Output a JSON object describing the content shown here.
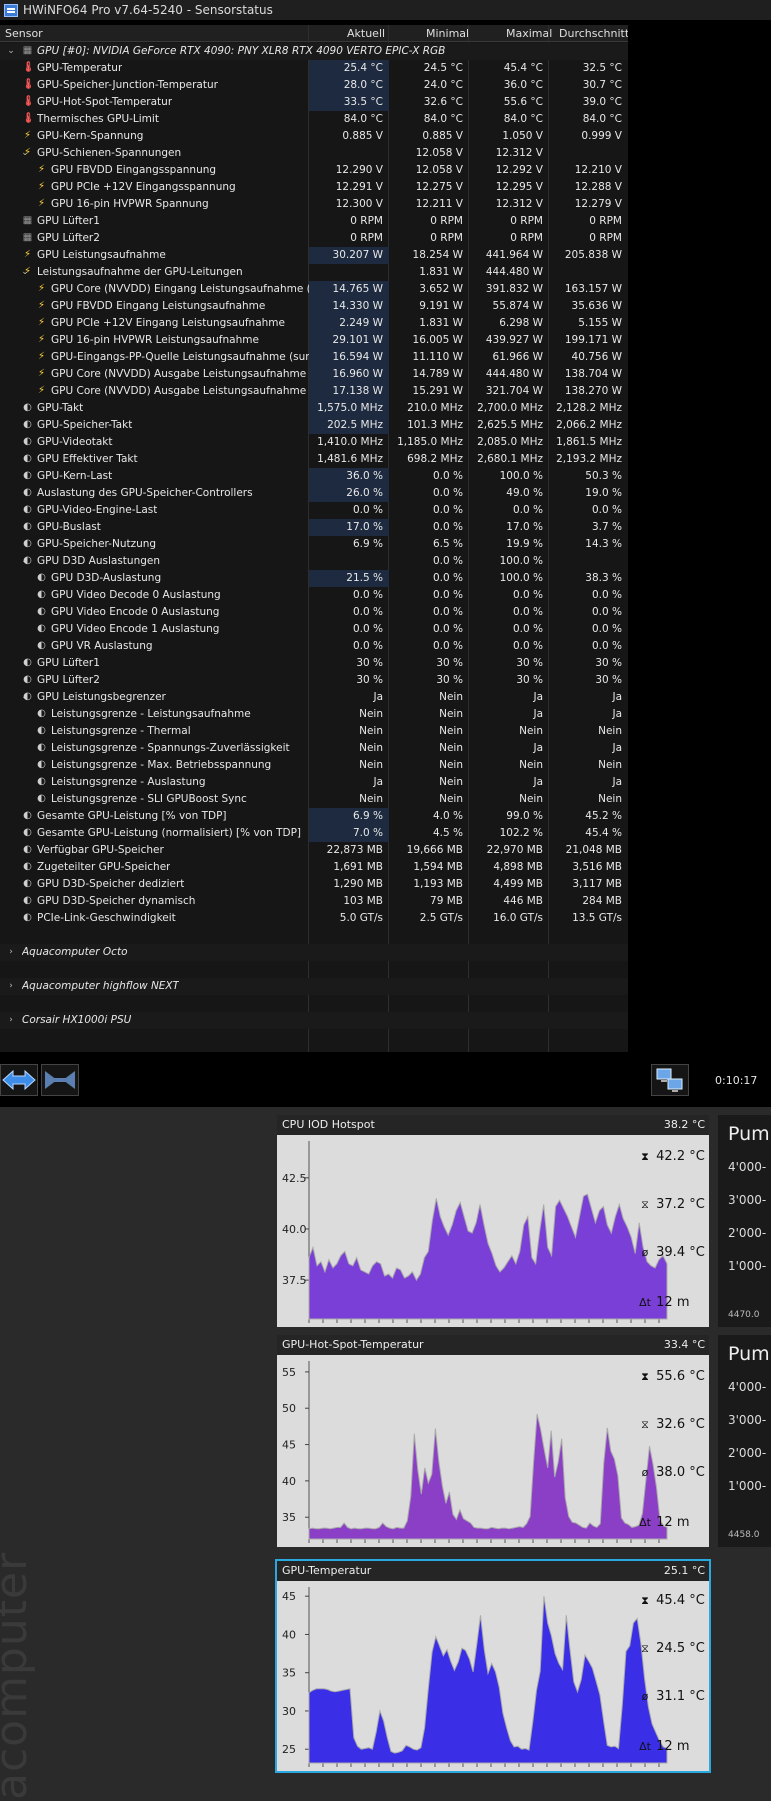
{
  "window": {
    "title": "HWiNFO64 Pro v7.64-5240 - Sensorstatus"
  },
  "columns": [
    "Sensor",
    "Aktuell",
    "Minimal",
    "Maximal",
    "Durchschnitt"
  ],
  "rows": [
    {
      "indent": 0,
      "exp": "down",
      "icon": "chip",
      "label": "GPU [#0]: NVIDIA GeForce RTX 4090: PNY XLR8 RTX 4090 VERTO EPIC-X RGB",
      "italic": true,
      "group": true,
      "v": [
        "",
        "",
        "",
        ""
      ]
    },
    {
      "indent": 1,
      "icon": "therm",
      "label": "GPU-Temperatur",
      "hl": true,
      "v": [
        "25.4 °C",
        "24.5 °C",
        "45.4 °C",
        "32.5 °C"
      ]
    },
    {
      "indent": 1,
      "icon": "therm",
      "label": "GPU-Speicher-Junction-Temperatur",
      "hl": true,
      "v": [
        "28.0 °C",
        "24.0 °C",
        "36.0 °C",
        "30.7 °C"
      ]
    },
    {
      "indent": 1,
      "icon": "therm",
      "label": "GPU-Hot-Spot-Temperatur",
      "hl": true,
      "v": [
        "33.5 °C",
        "32.6 °C",
        "55.6 °C",
        "39.0 °C"
      ]
    },
    {
      "indent": 1,
      "icon": "therm",
      "label": "Thermisches GPU-Limit",
      "v": [
        "84.0 °C",
        "84.0 °C",
        "84.0 °C",
        "84.0 °C"
      ]
    },
    {
      "indent": 1,
      "icon": "volt",
      "label": "GPU-Kern-Spannung",
      "v": [
        "0.885 V",
        "0.885 V",
        "1.050 V",
        "0.999 V"
      ]
    },
    {
      "indent": 1,
      "exp": "down",
      "icon": "volt",
      "label": "GPU-Schienen-Spannungen",
      "v": [
        "",
        "12.058 V",
        "12.312 V",
        ""
      ]
    },
    {
      "indent": 2,
      "icon": "volt",
      "label": "GPU FBVDD Eingangsspannung",
      "v": [
        "12.290 V",
        "12.058 V",
        "12.292 V",
        "12.210 V"
      ]
    },
    {
      "indent": 2,
      "icon": "volt",
      "label": "GPU PCIe +12V Eingangsspannung",
      "v": [
        "12.291 V",
        "12.275 V",
        "12.295 V",
        "12.288 V"
      ]
    },
    {
      "indent": 2,
      "icon": "volt",
      "label": "GPU 16-pin HVPWR Spannung",
      "v": [
        "12.300 V",
        "12.211 V",
        "12.312 V",
        "12.279 V"
      ]
    },
    {
      "indent": 1,
      "icon": "chip",
      "label": "GPU Lüfter1",
      "v": [
        "0 RPM",
        "0 RPM",
        "0 RPM",
        "0 RPM"
      ]
    },
    {
      "indent": 1,
      "icon": "chip",
      "label": "GPU Lüfter2",
      "v": [
        "0 RPM",
        "0 RPM",
        "0 RPM",
        "0 RPM"
      ]
    },
    {
      "indent": 1,
      "icon": "volt",
      "label": "GPU Leistungsaufnahme",
      "hl": true,
      "v": [
        "30.207 W",
        "18.254 W",
        "441.964 W",
        "205.838 W"
      ]
    },
    {
      "indent": 1,
      "exp": "down",
      "icon": "volt",
      "label": "Leistungsaufnahme der GPU-Leitungen",
      "v": [
        "",
        "1.831 W",
        "444.480 W",
        ""
      ]
    },
    {
      "indent": 2,
      "icon": "volt",
      "label": "GPU Core (NVVDD) Eingang Leistungsaufnahme (s...",
      "hl": true,
      "v": [
        "14.765 W",
        "3.652 W",
        "391.832 W",
        "163.157 W"
      ]
    },
    {
      "indent": 2,
      "icon": "volt",
      "label": "GPU FBVDD Eingang Leistungsaufnahme",
      "hl": true,
      "v": [
        "14.330 W",
        "9.191 W",
        "55.874 W",
        "35.636 W"
      ]
    },
    {
      "indent": 2,
      "icon": "volt",
      "label": "GPU PCIe +12V Eingang Leistungsaufnahme",
      "hl": true,
      "v": [
        "2.249 W",
        "1.831 W",
        "6.298 W",
        "5.155 W"
      ]
    },
    {
      "indent": 2,
      "icon": "volt",
      "label": "GPU 16-pin HVPWR Leistungsaufnahme",
      "hl": true,
      "v": [
        "29.101 W",
        "16.005 W",
        "439.927 W",
        "199.171 W"
      ]
    },
    {
      "indent": 2,
      "icon": "volt",
      "label": "GPU-Eingangs-PP-Quelle Leistungsaufnahme (sum)",
      "hl": true,
      "v": [
        "16.594 W",
        "11.110 W",
        "61.966 W",
        "40.756 W"
      ]
    },
    {
      "indent": 2,
      "icon": "volt",
      "label": "GPU Core (NVVDD) Ausgabe Leistungsaufnahme",
      "hl": true,
      "v": [
        "16.960 W",
        "14.789 W",
        "444.480 W",
        "138.704 W"
      ]
    },
    {
      "indent": 2,
      "icon": "volt",
      "label": "GPU Core (NVVDD) Ausgabe Leistungsaufnahme",
      "hl": true,
      "v": [
        "17.138 W",
        "15.291 W",
        "321.704 W",
        "138.270 W"
      ]
    },
    {
      "indent": 1,
      "icon": "clock",
      "label": "GPU-Takt",
      "hl": true,
      "v": [
        "1,575.0 MHz",
        "210.0 MHz",
        "2,700.0 MHz",
        "2,128.2 MHz"
      ]
    },
    {
      "indent": 1,
      "icon": "clock",
      "label": "GPU-Speicher-Takt",
      "hl": true,
      "v": [
        "202.5 MHz",
        "101.3 MHz",
        "2,625.5 MHz",
        "2,066.2 MHz"
      ]
    },
    {
      "indent": 1,
      "icon": "clock",
      "label": "GPU-Videotakt",
      "v": [
        "1,410.0 MHz",
        "1,185.0 MHz",
        "2,085.0 MHz",
        "1,861.5 MHz"
      ]
    },
    {
      "indent": 1,
      "icon": "clock",
      "label": "GPU Effektiver Takt",
      "v": [
        "1,481.6 MHz",
        "698.2 MHz",
        "2,680.1 MHz",
        "2,193.2 MHz"
      ]
    },
    {
      "indent": 1,
      "icon": "clock",
      "label": "GPU-Kern-Last",
      "hl": true,
      "v": [
        "36.0 %",
        "0.0 %",
        "100.0 %",
        "50.3 %"
      ]
    },
    {
      "indent": 1,
      "icon": "clock",
      "label": "Auslastung des GPU-Speicher-Controllers",
      "hl": true,
      "v": [
        "26.0 %",
        "0.0 %",
        "49.0 %",
        "19.0 %"
      ]
    },
    {
      "indent": 1,
      "icon": "clock",
      "label": "GPU-Video-Engine-Last",
      "v": [
        "0.0 %",
        "0.0 %",
        "0.0 %",
        "0.0 %"
      ]
    },
    {
      "indent": 1,
      "icon": "clock",
      "label": "GPU-Buslast",
      "hl": true,
      "v": [
        "17.0 %",
        "0.0 %",
        "17.0 %",
        "3.7 %"
      ]
    },
    {
      "indent": 1,
      "icon": "clock",
      "label": "GPU-Speicher-Nutzung",
      "v": [
        "6.9 %",
        "6.5 %",
        "19.9 %",
        "14.3 %"
      ]
    },
    {
      "indent": 1,
      "exp": "down",
      "icon": "clock",
      "label": "GPU D3D Auslastungen",
      "v": [
        "",
        "0.0 %",
        "100.0 %",
        ""
      ]
    },
    {
      "indent": 2,
      "icon": "clock",
      "label": "GPU D3D-Auslastung",
      "hl": true,
      "v": [
        "21.5 %",
        "0.0 %",
        "100.0 %",
        "38.3 %"
      ]
    },
    {
      "indent": 2,
      "icon": "clock",
      "label": "GPU Video Decode 0 Auslastung",
      "v": [
        "0.0 %",
        "0.0 %",
        "0.0 %",
        "0.0 %"
      ]
    },
    {
      "indent": 2,
      "icon": "clock",
      "label": "GPU Video Encode 0 Auslastung",
      "v": [
        "0.0 %",
        "0.0 %",
        "0.0 %",
        "0.0 %"
      ]
    },
    {
      "indent": 2,
      "icon": "clock",
      "label": "GPU Video Encode 1 Auslastung",
      "v": [
        "0.0 %",
        "0.0 %",
        "0.0 %",
        "0.0 %"
      ]
    },
    {
      "indent": 2,
      "icon": "clock",
      "label": "GPU VR Auslastung",
      "v": [
        "0.0 %",
        "0.0 %",
        "0.0 %",
        "0.0 %"
      ]
    },
    {
      "indent": 1,
      "icon": "clock",
      "label": "GPU Lüfter1",
      "v": [
        "30 %",
        "30 %",
        "30 %",
        "30 %"
      ]
    },
    {
      "indent": 1,
      "icon": "clock",
      "label": "GPU Lüfter2",
      "v": [
        "30 %",
        "30 %",
        "30 %",
        "30 %"
      ]
    },
    {
      "indent": 1,
      "exp": "down",
      "icon": "clock",
      "label": "GPU Leistungsbegrenzer",
      "v": [
        "Ja",
        "Nein",
        "Ja",
        "Ja"
      ]
    },
    {
      "indent": 2,
      "icon": "clock",
      "label": "Leistungsgrenze - Leistungsaufnahme",
      "v": [
        "Nein",
        "Nein",
        "Ja",
        "Ja"
      ]
    },
    {
      "indent": 2,
      "icon": "clock",
      "label": "Leistungsgrenze - Thermal",
      "v": [
        "Nein",
        "Nein",
        "Nein",
        "Nein"
      ]
    },
    {
      "indent": 2,
      "icon": "clock",
      "label": "Leistungsgrenze - Spannungs-Zuverlässigkeit",
      "v": [
        "Nein",
        "Nein",
        "Ja",
        "Ja"
      ]
    },
    {
      "indent": 2,
      "icon": "clock",
      "label": "Leistungsgrenze - Max. Betriebsspannung",
      "v": [
        "Nein",
        "Nein",
        "Nein",
        "Nein"
      ]
    },
    {
      "indent": 2,
      "icon": "clock",
      "label": "Leistungsgrenze - Auslastung",
      "v": [
        "Ja",
        "Nein",
        "Ja",
        "Ja"
      ]
    },
    {
      "indent": 2,
      "icon": "clock",
      "label": "Leistungsgrenze - SLI GPUBoost Sync",
      "v": [
        "Nein",
        "Nein",
        "Nein",
        "Nein"
      ]
    },
    {
      "indent": 1,
      "icon": "clock",
      "label": "Gesamte GPU-Leistung [% von TDP]",
      "hl": true,
      "v": [
        "6.9 %",
        "4.0 %",
        "99.0 %",
        "45.2 %"
      ]
    },
    {
      "indent": 1,
      "icon": "clock",
      "label": "Gesamte GPU-Leistung (normalisiert) [% von TDP]",
      "hl": true,
      "v": [
        "7.0 %",
        "4.5 %",
        "102.2 %",
        "45.4 %"
      ]
    },
    {
      "indent": 1,
      "icon": "clock",
      "label": "Verfügbar GPU-Speicher",
      "v": [
        "22,873 MB",
        "19,666 MB",
        "22,970 MB",
        "21,048 MB"
      ]
    },
    {
      "indent": 1,
      "icon": "clock",
      "label": "Zugeteilter GPU-Speicher",
      "v": [
        "1,691 MB",
        "1,594 MB",
        "4,898 MB",
        "3,516 MB"
      ]
    },
    {
      "indent": 1,
      "icon": "clock",
      "label": "GPU D3D-Speicher dediziert",
      "v": [
        "1,290 MB",
        "1,193 MB",
        "4,499 MB",
        "3,117 MB"
      ]
    },
    {
      "indent": 1,
      "icon": "clock",
      "label": "GPU D3D-Speicher dynamisch",
      "v": [
        "103 MB",
        "79 MB",
        "446 MB",
        "284 MB"
      ]
    },
    {
      "indent": 1,
      "icon": "clock",
      "label": "PCIe-Link-Geschwindigkeit",
      "v": [
        "5.0 GT/s",
        "2.5 GT/s",
        "16.0 GT/s",
        "13.5 GT/s"
      ]
    },
    {
      "spacer": true
    },
    {
      "indent": 0,
      "exp": "right",
      "icon": "none",
      "label": "Aquacomputer Octo",
      "italic": true,
      "group": true,
      "v": [
        "",
        "",
        "",
        ""
      ]
    },
    {
      "spacer": true
    },
    {
      "indent": 0,
      "exp": "right",
      "icon": "none",
      "label": "Aquacomputer highflow NEXT",
      "italic": true,
      "group": true,
      "v": [
        "",
        "",
        "",
        ""
      ]
    },
    {
      "spacer": true
    },
    {
      "indent": 0,
      "exp": "right",
      "icon": "none",
      "label": "Corsair HX1000i PSU",
      "italic": true,
      "group": true,
      "v": [
        "",
        "",
        "",
        ""
      ]
    }
  ],
  "toolbar": {
    "timer": "0:10:17"
  },
  "brand_text": "acomputer",
  "graphs": [
    {
      "title": "CPU IOD Hotspot",
      "current": "38.2 °C",
      "ymin": 35.6,
      "ymax": 44.3,
      "ticks": [
        {
          "v": 42.5,
          "label": "42.5"
        },
        {
          "v": 40.0,
          "label": "40.0"
        },
        {
          "v": 37.5,
          "label": "37.5"
        }
      ],
      "max": "42.2 °C",
      "min": "37.2 °C",
      "avg": "39.4 °C",
      "span": "12 m",
      "fill": "#7a3fd6",
      "selected": false,
      "values": [
        38.6,
        39.1,
        38.2,
        38.4,
        37.9,
        38.5,
        38.1,
        38.3,
        38.7,
        38.9,
        38.3,
        38.2,
        38.6,
        38.0,
        37.9,
        37.8,
        38.2,
        38.4,
        38.3,
        37.7,
        37.8,
        37.6,
        38.1,
        38.0,
        37.6,
        37.7,
        37.9,
        37.5,
        37.8,
        38.6,
        38.9,
        40.4,
        41.5,
        40.6,
        40.1,
        39.7,
        40.2,
        40.9,
        41.3,
        40.6,
        39.9,
        39.8,
        40.3,
        41.2,
        40.2,
        39.3,
        38.8,
        38.2,
        37.9,
        38.1,
        38.4,
        38.7,
        38.3,
        38.9,
        40.2,
        40.6,
        38.6,
        38.3,
        39.9,
        41.2,
        39.1,
        38.7,
        41.1,
        41.4,
        41.0,
        40.6,
        40.1,
        39.6,
        40.6,
        41.6,
        41.7,
        41.0,
        40.3,
        40.9,
        41.1,
        40.2,
        39.8,
        40.6,
        41.2,
        40.5,
        40.1,
        39.6,
        38.8,
        40.3,
        39.1,
        38.4,
        38.2,
        38.1,
        38.5,
        38.7,
        38.3
      ]
    },
    {
      "title": "GPU-Hot-Spot-Temperatur",
      "current": "33.4 °C",
      "ymin": 32.0,
      "ymax": 56.5,
      "ticks": [
        {
          "v": 55,
          "label": "55"
        },
        {
          "v": 50,
          "label": "50"
        },
        {
          "v": 45,
          "label": "45"
        },
        {
          "v": 40,
          "label": "40"
        },
        {
          "v": 35,
          "label": "35"
        }
      ],
      "max": "55.6 °C",
      "min": "32.6 °C",
      "avg": "38.0 °C",
      "span": "12 m",
      "fill": "#8a3fc6",
      "selected": false,
      "values": [
        33.4,
        33.5,
        33.4,
        33.4,
        33.5,
        33.5,
        33.4,
        33.5,
        33.6,
        33.6,
        34.2,
        33.6,
        33.4,
        33.5,
        33.4,
        33.4,
        33.5,
        33.5,
        33.4,
        33.4,
        33.6,
        34.2,
        33.7,
        33.5,
        33.4,
        33.6,
        33.5,
        33.5,
        34.5,
        37.9,
        46.5,
        41.5,
        38.2,
        41.8,
        39.7,
        40.9,
        47.2,
        42.6,
        39.3,
        36.9,
        38.5,
        35.4,
        34.7,
        36.0,
        34.8,
        34.5,
        34.2,
        33.6,
        33.5,
        33.5,
        33.4,
        33.4,
        33.6,
        33.5,
        33.4,
        33.5,
        33.5,
        33.4,
        33.5,
        33.6,
        33.7,
        33.6,
        34.1,
        35.1,
        42.6,
        49.2,
        47.1,
        44.3,
        41.8,
        46.9,
        40.5,
        42.6,
        45.8,
        37.7,
        35.1,
        34.3,
        34.2,
        33.9,
        33.6,
        33.5,
        34.2,
        33.8,
        33.6,
        34.1,
        42.5,
        47.3,
        44.1,
        43.0,
        40.7,
        34.9,
        34.2,
        34.0,
        33.6,
        33.7,
        33.9,
        35.5,
        40.1,
        44.8,
        42.3,
        39.1,
        34.6,
        33.8,
        33.6
      ]
    },
    {
      "title": "GPU-Temperatur",
      "current": "25.1 °C",
      "ymin": 23.2,
      "ymax": 46.2,
      "ticks": [
        {
          "v": 45,
          "label": "45"
        },
        {
          "v": 40,
          "label": "40"
        },
        {
          "v": 35,
          "label": "35"
        },
        {
          "v": 30,
          "label": "30"
        },
        {
          "v": 25,
          "label": "25"
        }
      ],
      "max": "45.4 °C",
      "min": "24.5 °C",
      "avg": "31.1 °C",
      "span": "12 m",
      "fill": "#3a2fe6",
      "selected": true,
      "values": [
        32.4,
        32.7,
        32.9,
        32.9,
        32.9,
        32.8,
        32.6,
        32.5,
        32.6,
        32.7,
        32.8,
        32.9,
        26.5,
        25.4,
        25.0,
        25.1,
        25.2,
        25.0,
        27.2,
        30.0,
        28.7,
        26.5,
        24.7,
        24.5,
        24.6,
        24.8,
        25.5,
        25.3,
        25.0,
        24.9,
        25.2,
        27.8,
        32.9,
        37.7,
        39.7,
        38.5,
        37.2,
        38.0,
        36.5,
        35.3,
        36.4,
        38.2,
        37.9,
        36.8,
        35.1,
        38.7,
        42.5,
        38.0,
        34.9,
        36.2,
        35.1,
        33.1,
        29.7,
        27.8,
        26.1,
        25.3,
        25.4,
        25.0,
        25.1,
        24.9,
        28.6,
        32.7,
        35.2,
        45.0,
        41.5,
        39.8,
        37.5,
        36.2,
        35.4,
        42.5,
        38.0,
        33.8,
        32.5,
        34.1,
        37.3,
        36.5,
        35.6,
        33.9,
        32.1,
        28.7,
        25.5,
        25.3,
        25.4,
        25.1,
        30.8,
        37.8,
        38.5,
        41.5,
        42.1,
        38.8,
        34.2,
        30.5,
        28.3,
        27.2,
        26.1,
        25.3,
        25.1
      ]
    }
  ],
  "sidecards": [
    {
      "title": "Pump",
      "ticks": [
        "4'000-",
        "3'000-",
        "2'000-",
        "1'000-"
      ],
      "bottom": "4470.0"
    },
    {
      "title": "Pump",
      "ticks": [
        "4'000-",
        "3'000-",
        "2'000-",
        "1'000-"
      ],
      "bottom": "4458.0"
    }
  ]
}
